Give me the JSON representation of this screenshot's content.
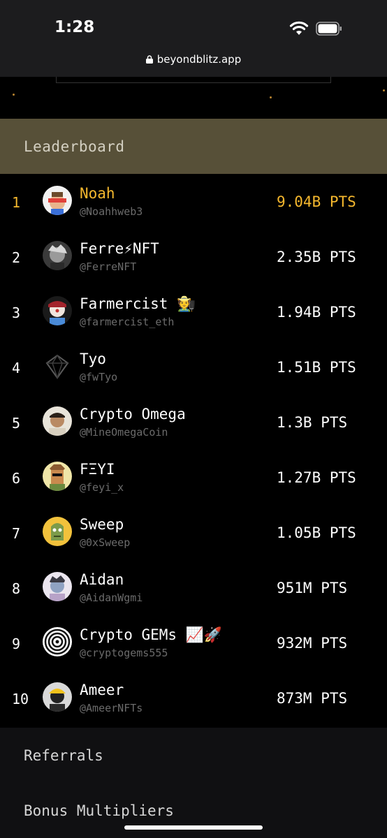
{
  "status_bar": {
    "time": "1:28",
    "url": "beyondblitz.app"
  },
  "leaderboard": {
    "title": "Leaderboard",
    "accent_color": "#f5b82e",
    "entries": [
      {
        "rank": "1",
        "name": "Noah",
        "handle": "@Noahhweb3",
        "points": "9.04B PTS"
      },
      {
        "rank": "2",
        "name": "Ferre⚡NFT",
        "handle": "@FerreNFT",
        "points": "2.35B PTS"
      },
      {
        "rank": "3",
        "name": "Farmercist 🧑‍🌾",
        "handle": "@farmercist_eth",
        "points": "1.94B PTS"
      },
      {
        "rank": "4",
        "name": "Tyo",
        "handle": "@fwTyo",
        "points": "1.51B PTS"
      },
      {
        "rank": "5",
        "name": "Crypto Omega",
        "handle": "@MineOmegaCoin",
        "points": "1.3B PTS"
      },
      {
        "rank": "6",
        "name": "FΞYI",
        "handle": "@feyi_x",
        "points": "1.27B PTS"
      },
      {
        "rank": "7",
        "name": "Sweep",
        "handle": "@0xSweep",
        "points": "1.05B PTS"
      },
      {
        "rank": "8",
        "name": "Aidan",
        "handle": "@AidanWgmi",
        "points": "951M PTS"
      },
      {
        "rank": "9",
        "name": "Crypto GEMs 📈🚀",
        "handle": "@cryptogems555",
        "points": "932M PTS"
      },
      {
        "rank": "10",
        "name": "Ameer",
        "handle": "@AmeerNFTs",
        "points": "873M PTS"
      }
    ]
  },
  "sections": {
    "referrals": "Referrals",
    "bonus_multipliers": "Bonus Multipliers"
  },
  "icons": [
    "wifi-icon",
    "battery-icon",
    "lock-icon"
  ]
}
